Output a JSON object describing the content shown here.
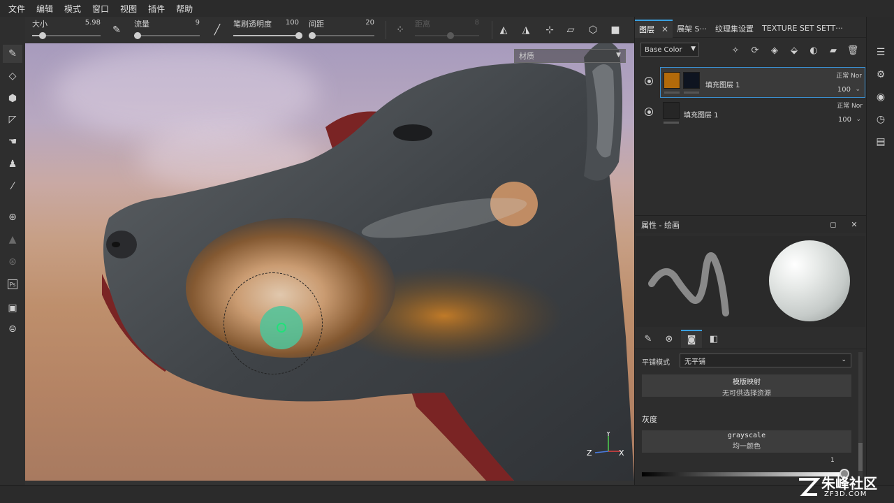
{
  "menu": [
    "文件",
    "编辑",
    "模式",
    "窗口",
    "视图",
    "插件",
    "帮助"
  ],
  "toolbar": {
    "size": {
      "label": "大小",
      "value": "5.98",
      "fraction": 0.15
    },
    "flow": {
      "label": "流量",
      "value": "9",
      "fraction": 0.05
    },
    "opacity": {
      "label": "笔刷透明度",
      "value": "100",
      "fraction": 1.0
    },
    "spacing": {
      "label": "间距",
      "value": "20",
      "fraction": 0.05
    },
    "distance": {
      "label": "距离",
      "value": "8",
      "fraction": 0.55
    }
  },
  "viewport": {
    "material_select": "材质",
    "axis": {
      "y": "Y",
      "z": "Z",
      "x": "X"
    }
  },
  "layers_panel": {
    "tabs": [
      "图层",
      "展架 S···",
      "纹理集设置",
      "TEXTURE SET SETT···"
    ],
    "channel": "Base Color",
    "layers": [
      {
        "name": "填充图层 1",
        "blend": "正常 Nor",
        "opacity": "100",
        "thumb_color": "#b36a0a",
        "mask_color": "#0e1420"
      },
      {
        "name": "填充图层 1",
        "blend": "正常 Nor",
        "opacity": "100",
        "thumb_color": "#262626"
      }
    ]
  },
  "properties": {
    "title": "属性 - 绘画",
    "tiling_label": "平铺模式",
    "tiling_value": "无平铺",
    "stencil": {
      "title": "模版映射",
      "subtitle": "无可供选择资源"
    },
    "gray_section": "灰度",
    "grayscale": {
      "title": "grayscale",
      "subtitle": "均一颜色",
      "value": "1"
    }
  },
  "watermark": {
    "text": "朱峰社区",
    "url": "ZF3D.COM"
  },
  "colors": {
    "accent": "#3aa0e0",
    "panel": "#2d2d2d",
    "brush_cursor": "#4fc49a"
  }
}
